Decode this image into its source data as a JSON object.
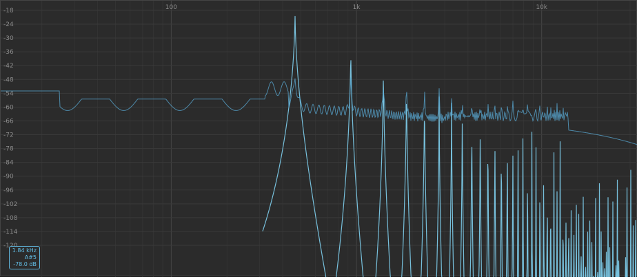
{
  "chart_data": {
    "type": "line",
    "title": "",
    "xlabel": "",
    "ylabel": "",
    "x_scale": "log",
    "x_ticks": [
      "100",
      "1k",
      "10k"
    ],
    "x_tick_values": [
      100,
      1000,
      10000
    ],
    "ylim": [
      -126,
      -18
    ],
    "y_ticks": [
      -18,
      -24,
      -30,
      -36,
      -42,
      -48,
      -54,
      -60,
      -66,
      -72,
      -78,
      -84,
      -90,
      -96,
      -102,
      -108,
      -114,
      -120
    ],
    "grid": true,
    "fundamental_hz": 466,
    "harmonic_peaks_db": [
      -18,
      -32,
      -40,
      -46,
      -50,
      -53,
      -55,
      -56,
      -57,
      -58,
      -59,
      -60,
      -61,
      -62,
      -63,
      -64,
      -65,
      -66,
      -67,
      -68
    ],
    "series": [
      {
        "color": "#5aa9d4",
        "style": "smoothed average"
      },
      {
        "color": "#7fd0f0",
        "style": "peaks"
      }
    ]
  },
  "readout": {
    "frequency": "1.84 kHz",
    "note": "A#5",
    "level": "-78.0 dB"
  },
  "colors": {
    "background": "#2b2b2b",
    "grid": "#3a3a3a",
    "label": "#8a8a8a",
    "accent": "#63c0e8"
  }
}
